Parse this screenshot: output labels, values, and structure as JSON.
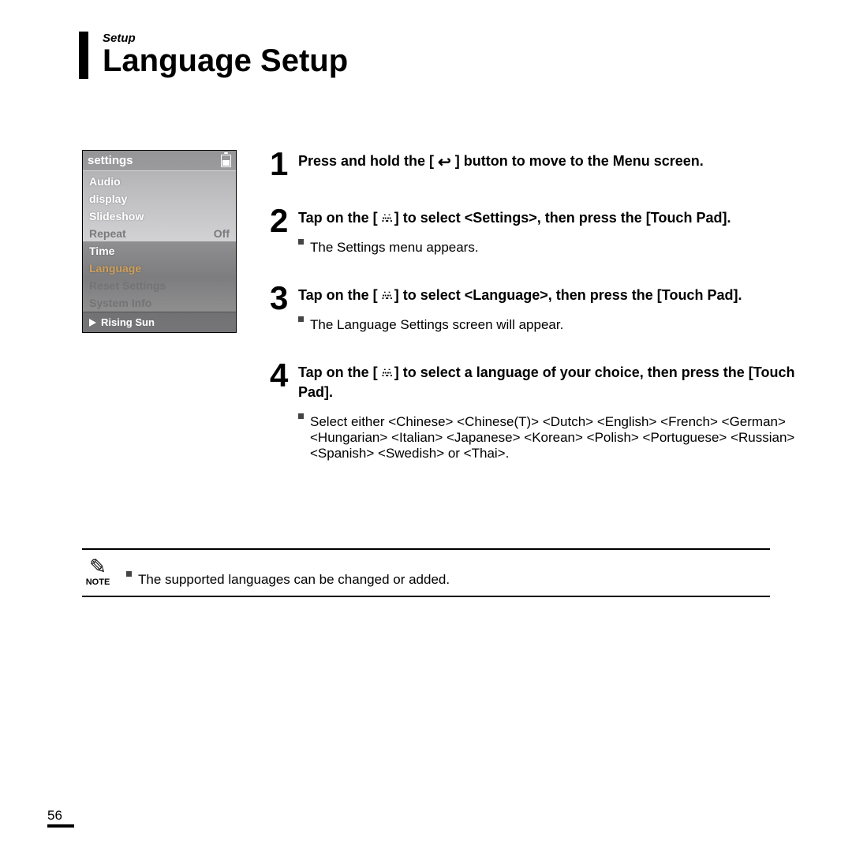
{
  "header": {
    "section_label": "Setup",
    "title": "Language Setup"
  },
  "device_screen": {
    "header_title": "settings",
    "menu": [
      {
        "label": "Audio",
        "value": ""
      },
      {
        "label": "display",
        "value": ""
      },
      {
        "label": "Slideshow",
        "value": ""
      },
      {
        "label": "Repeat",
        "value": "Off"
      },
      {
        "label": "Time",
        "value": ""
      },
      {
        "label": "Language",
        "value": "",
        "highlight": true
      },
      {
        "label": "Reset Settings",
        "value": "",
        "dim": true
      },
      {
        "label": "System Info",
        "value": "",
        "dim": true
      }
    ],
    "now_playing": "Rising Sun"
  },
  "steps": [
    {
      "num": "1",
      "title_pre": "Press and hold the [ ",
      "title_post": " ] button to move to the Menu screen.",
      "icon": "arrow"
    },
    {
      "num": "2",
      "title_pre": "Tap on the [ ",
      "title_post": " ] to select <Settings>,  then press the [Touch Pad].",
      "icon": "dots",
      "sub": "The Settings menu appears."
    },
    {
      "num": "3",
      "title_pre": "Tap on the [ ",
      "title_post": " ] to select <Language>, then press the [Touch Pad].",
      "icon": "dots",
      "sub": "The Language Settings screen will appear."
    },
    {
      "num": "4",
      "title_pre": "Tap on the [ ",
      "title_post": " ] to select a language of your choice, then press the [Touch Pad].",
      "icon": "dots",
      "sub": "Select either <Chinese> <Chinese(T)> <Dutch> <English> <French> <German> <Hungarian> <Italian> <Japanese> <Korean> <Polish> <Portuguese> <Russian> <Spanish> <Swedish> or <Thai>."
    }
  ],
  "note": {
    "label": "NOTE",
    "text": "The supported languages can be changed or added."
  },
  "page_number": "56"
}
